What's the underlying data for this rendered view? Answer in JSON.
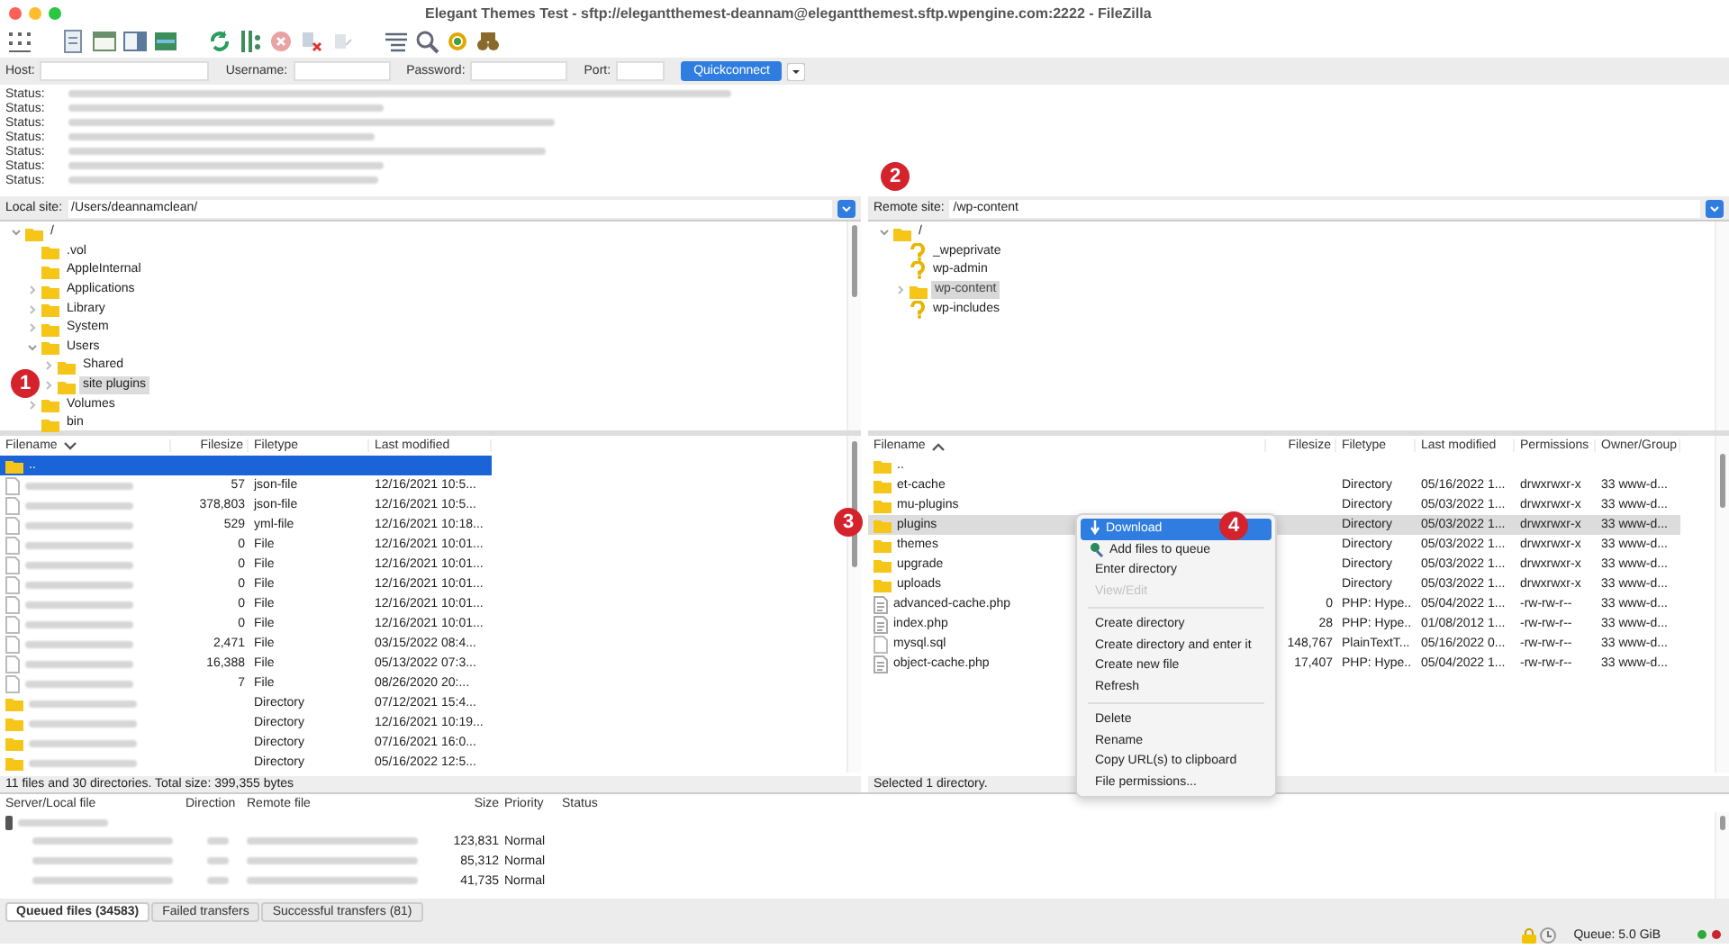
{
  "window": {
    "title": "Elegant Themes Test - sftp://elegantthemest-deannam@elegantthemest.sftp.wpengine.com:2222 - FileZilla"
  },
  "quickconnect": {
    "fields": [
      {
        "label": "Host:"
      },
      {
        "label": "Username:"
      },
      {
        "label": "Password:"
      },
      {
        "label": "Port:"
      }
    ],
    "button": "Quickconnect"
  },
  "log": {
    "lines": [
      {
        "label": "Status:"
      },
      {
        "label": "Status:"
      },
      {
        "label": "Status:"
      },
      {
        "label": "Status:"
      },
      {
        "label": "Status:"
      },
      {
        "label": "Status:"
      },
      {
        "label": "Status:"
      }
    ]
  },
  "local": {
    "site_label": "Local site:",
    "path": "/Users/deannamclean/",
    "tree": [
      {
        "label": "/",
        "kind": "folder",
        "expanded": true,
        "selected": false,
        "children": [
          {
            "label": ".vol",
            "kind": "folder",
            "selected": false
          },
          {
            "label": "AppleInternal",
            "kind": "folder",
            "selected": false
          },
          {
            "label": "Applications",
            "kind": "folder",
            "expanded": false,
            "selected": false
          },
          {
            "label": "Library",
            "kind": "folder",
            "expanded": false,
            "selected": false
          },
          {
            "label": "System",
            "kind": "folder",
            "expanded": false,
            "selected": false
          },
          {
            "label": "Users",
            "kind": "folder",
            "expanded": true,
            "selected": false,
            "children": [
              {
                "label": "Shared",
                "kind": "folder",
                "expanded": false,
                "selected": false
              },
              {
                "label": "site plugins",
                "kind": "folder",
                "expanded": false,
                "selected": true
              }
            ]
          },
          {
            "label": "Volumes",
            "kind": "folder",
            "expanded": false,
            "selected": false
          },
          {
            "label": "bin",
            "kind": "folder",
            "selected": false
          }
        ]
      }
    ],
    "columns": [
      "Filename",
      "Filesize",
      "Filetype",
      "Last modified"
    ],
    "rows": [
      {
        "kind": "parent",
        "name": "..",
        "selected": true
      },
      {
        "kind": "file",
        "size": "57",
        "type": "json-file",
        "modified": "12/16/2021 10:5...",
        "selected": false
      },
      {
        "kind": "file",
        "size": "378,803",
        "type": "json-file",
        "modified": "12/16/2021 10:5...",
        "selected": false
      },
      {
        "kind": "file",
        "size": "529",
        "type": "yml-file",
        "modified": "12/16/2021 10:18...",
        "selected": false
      },
      {
        "kind": "file",
        "size": "0",
        "type": "File",
        "modified": "12/16/2021 10:01...",
        "selected": false
      },
      {
        "kind": "file",
        "size": "0",
        "type": "File",
        "modified": "12/16/2021 10:01...",
        "selected": false
      },
      {
        "kind": "file",
        "size": "0",
        "type": "File",
        "modified": "12/16/2021 10:01...",
        "selected": false
      },
      {
        "kind": "file",
        "size": "0",
        "type": "File",
        "modified": "12/16/2021 10:01...",
        "selected": false
      },
      {
        "kind": "file",
        "size": "0",
        "type": "File",
        "modified": "12/16/2021 10:01...",
        "selected": false
      },
      {
        "kind": "file",
        "size": "2,471",
        "type": "File",
        "modified": "03/15/2022 08:4...",
        "selected": false
      },
      {
        "kind": "file",
        "size": "16,388",
        "type": "File",
        "modified": "05/13/2022 07:3...",
        "selected": false
      },
      {
        "kind": "file",
        "size": "7",
        "type": "File",
        "modified": "08/26/2020 20:...",
        "selected": false
      },
      {
        "kind": "folder",
        "type": "Directory",
        "modified": "07/12/2021 15:4...",
        "selected": false
      },
      {
        "kind": "folder",
        "type": "Directory",
        "modified": "12/16/2021 10:19...",
        "selected": false
      },
      {
        "kind": "folder",
        "type": "Directory",
        "modified": "07/16/2021 16:0...",
        "selected": false
      },
      {
        "kind": "folder",
        "type": "Directory",
        "modified": "05/16/2022 12:5...",
        "selected": false
      }
    ],
    "status": "11 files and 30 directories. Total size: 399,355 bytes"
  },
  "remote": {
    "site_label": "Remote site:",
    "path": "/wp-content",
    "tree": [
      {
        "label": "/",
        "kind": "folder",
        "expanded": true,
        "selected": false,
        "children": [
          {
            "label": "_wpeprivate",
            "kind": "unknown",
            "selected": false
          },
          {
            "label": "wp-admin",
            "kind": "unknown",
            "selected": false
          },
          {
            "label": "wp-content",
            "kind": "folder",
            "expanded": false,
            "selected": true
          },
          {
            "label": "wp-includes",
            "kind": "unknown",
            "selected": false
          }
        ]
      }
    ],
    "columns": [
      "Filename",
      "Filesize",
      "Filetype",
      "Last modified",
      "Permissions",
      "Owner/Group"
    ],
    "rows": [
      {
        "kind": "folder",
        "name": "..",
        "selected": false
      },
      {
        "kind": "folder",
        "name": "et-cache",
        "type": "Directory",
        "modified": "05/16/2022 1...",
        "perms": "drwxrwxr-x",
        "owner": "33 www-d...",
        "selected": false
      },
      {
        "kind": "folder",
        "name": "mu-plugins",
        "type": "Directory",
        "modified": "05/03/2022 1...",
        "perms": "drwxrwxr-x",
        "owner": "33 www-d...",
        "selected": false
      },
      {
        "kind": "folder",
        "name": "plugins",
        "type": "Directory",
        "modified": "05/03/2022 1...",
        "perms": "drwxrwxr-x",
        "owner": "33 www-d...",
        "selected": true
      },
      {
        "kind": "folder",
        "name": "themes",
        "type": "Directory",
        "modified": "05/03/2022 1...",
        "perms": "drwxrwxr-x",
        "owner": "33 www-d...",
        "selected": false
      },
      {
        "kind": "folder",
        "name": "upgrade",
        "type": "Directory",
        "modified": "05/03/2022 1...",
        "perms": "drwxrwxr-x",
        "owner": "33 www-d...",
        "selected": false
      },
      {
        "kind": "folder",
        "name": "uploads",
        "type": "Directory",
        "modified": "05/03/2022 1...",
        "perms": "drwxrwxr-x",
        "owner": "33 www-d...",
        "selected": false
      },
      {
        "kind": "script",
        "name": "advanced-cache.php",
        "size": "0",
        "type": "PHP: Hype..",
        "modified": "05/04/2022 1...",
        "perms": "-rw-rw-r--",
        "owner": "33 www-d...",
        "selected": false
      },
      {
        "kind": "script",
        "name": "index.php",
        "size": "28",
        "type": "PHP: Hype..",
        "modified": "01/08/2012 1...",
        "perms": "-rw-rw-r--",
        "owner": "33 www-d...",
        "selected": false
      },
      {
        "kind": "file",
        "name": "mysql.sql",
        "size": "148,767",
        "type": "PlainTextT...",
        "modified": "05/16/2022 0...",
        "perms": "-rw-rw-r--",
        "owner": "33 www-d...",
        "selected": false
      },
      {
        "kind": "script",
        "name": "object-cache.php",
        "size": "17,407",
        "type": "PHP: Hype..",
        "modified": "05/04/2022 1...",
        "perms": "-rw-rw-r--",
        "owner": "33 www-d...",
        "selected": false
      }
    ],
    "status": "Selected 1 directory."
  },
  "context_menu": {
    "items": [
      {
        "kind": "download",
        "label": "Download",
        "selected": true,
        "disabled": false
      },
      {
        "kind": "queue",
        "label": "Add files to queue",
        "selected": false,
        "disabled": false
      },
      {
        "kind": "item",
        "label": "Enter directory",
        "selected": false,
        "disabled": false
      },
      {
        "kind": "item",
        "label": "View/Edit",
        "selected": false,
        "disabled": true
      },
      {
        "kind": "separator"
      },
      {
        "kind": "item",
        "label": "Create directory",
        "selected": false,
        "disabled": false
      },
      {
        "kind": "item",
        "label": "Create directory and enter it",
        "selected": false,
        "disabled": false
      },
      {
        "kind": "item",
        "label": "Create new file",
        "selected": false,
        "disabled": false
      },
      {
        "kind": "item",
        "label": "Refresh",
        "selected": false,
        "disabled": false
      },
      {
        "kind": "separator"
      },
      {
        "kind": "item",
        "label": "Delete",
        "selected": false,
        "disabled": false
      },
      {
        "kind": "item",
        "label": "Rename",
        "selected": false,
        "disabled": false
      },
      {
        "kind": "item",
        "label": "Copy URL(s) to clipboard",
        "selected": false,
        "disabled": false
      },
      {
        "kind": "item",
        "label": "File permissions...",
        "selected": false,
        "disabled": false
      }
    ]
  },
  "callouts": [
    "1",
    "2",
    "3",
    "4"
  ],
  "queue": {
    "columns": [
      "Server/Local file",
      "Direction",
      "Remote file",
      "Size",
      "Priority",
      "Status"
    ],
    "rows": [
      {
        "kind": "server"
      },
      {
        "kind": "file",
        "size": "123,831",
        "priority": "Normal"
      },
      {
        "kind": "file",
        "size": "85,312",
        "priority": "Normal"
      },
      {
        "kind": "file",
        "size": "41,735",
        "priority": "Normal"
      }
    ]
  },
  "tabs": [
    {
      "label": "Queued files (34583)",
      "selected": true
    },
    {
      "label": "Failed transfers",
      "selected": false
    },
    {
      "label": "Successful transfers (81)",
      "selected": false
    }
  ],
  "status_bar": {
    "queue": "Queue: 5.0 GiB"
  }
}
